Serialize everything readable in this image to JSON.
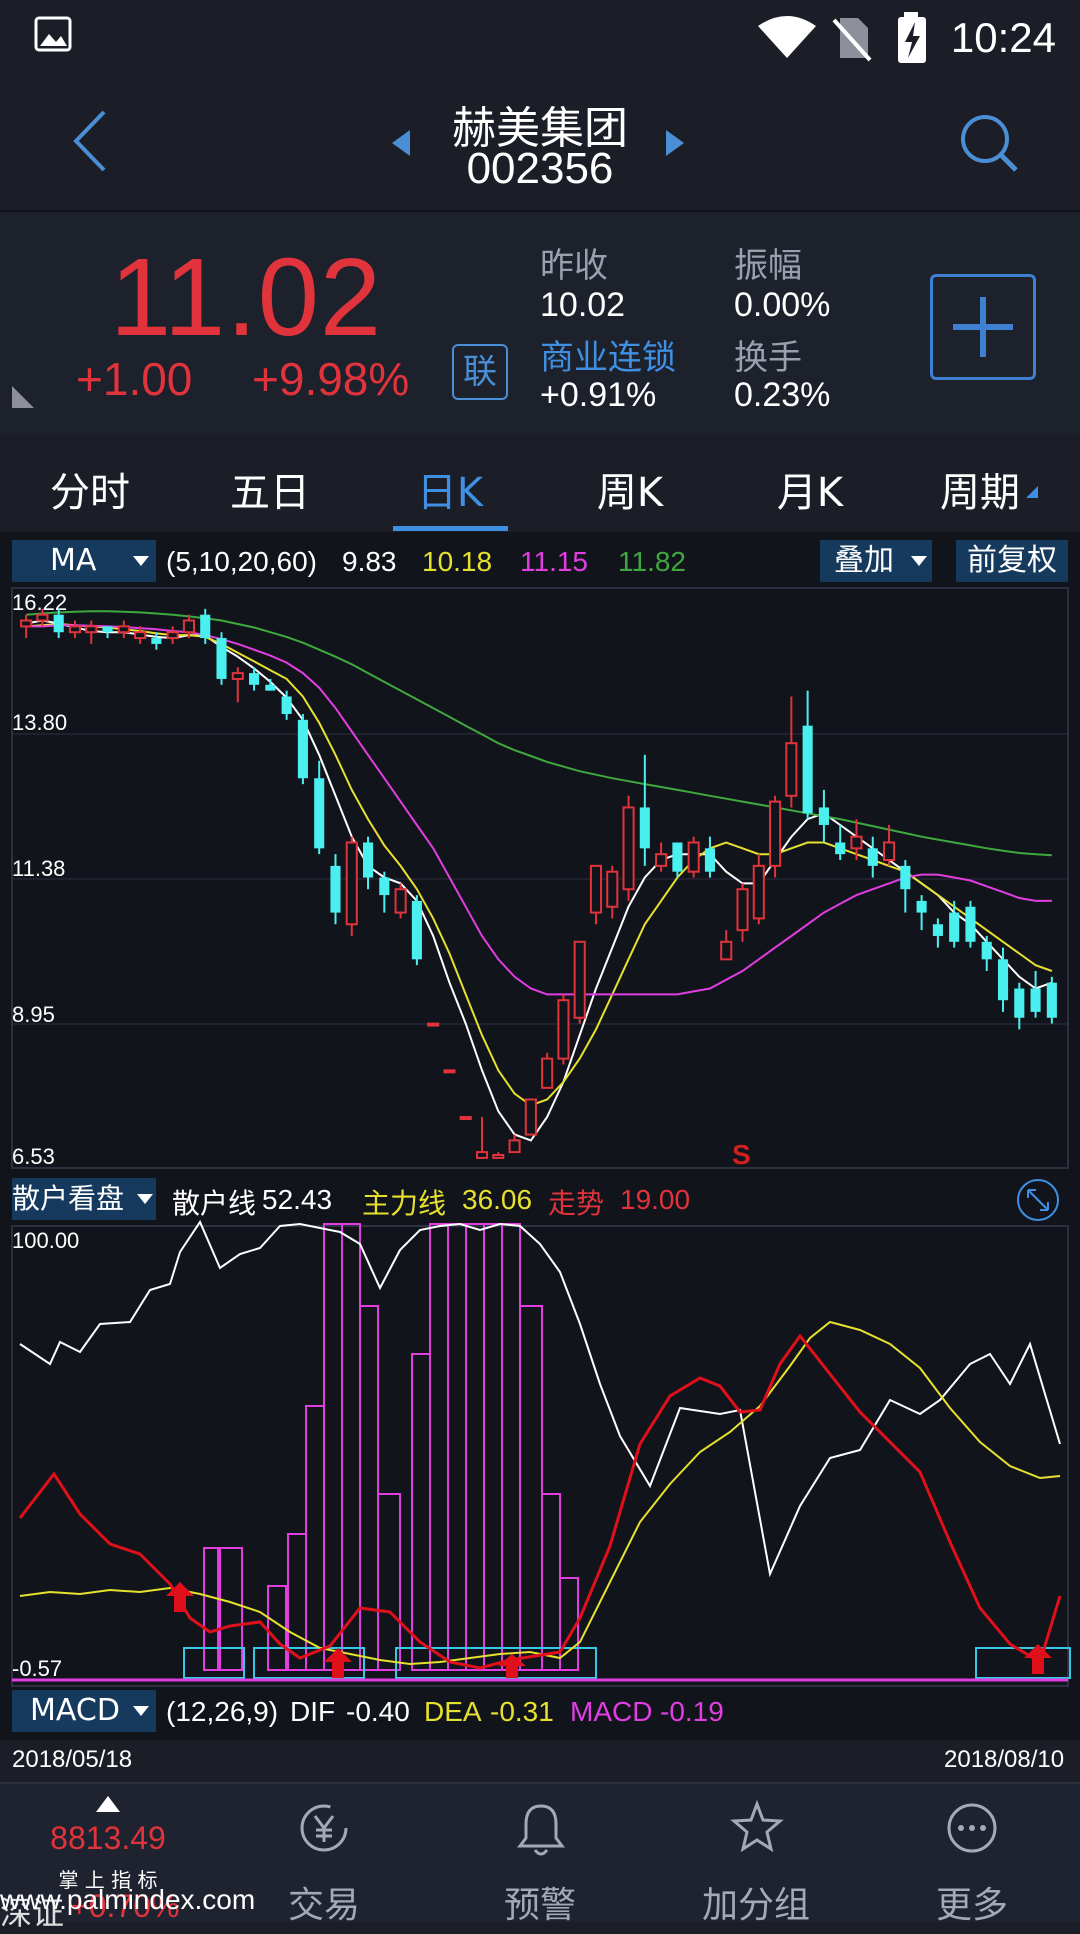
{
  "status": {
    "time": "10:24"
  },
  "header": {
    "name": "赫美集团",
    "code": "002356"
  },
  "quote": {
    "price": "11.02",
    "change": "+1.00",
    "change_pct": "+9.98%",
    "prev_close_label": "昨收",
    "prev_close": "10.02",
    "amplitude_label": "振幅",
    "amplitude": "0.00%",
    "sector": "商业连锁",
    "sector_change": "+0.91%",
    "turnover_label": "换手",
    "turnover": "0.23%",
    "lian": "联"
  },
  "tabs": [
    "分时",
    "五日",
    "日K",
    "周K",
    "月K",
    "周期"
  ],
  "active_tab": 2,
  "ma": {
    "selector": "MA",
    "params": "(5,10,20,60)",
    "v1": "9.83",
    "v2": "10.18",
    "v3": "11.15",
    "v4": "11.82",
    "overlay": "叠加",
    "adjust": "前复权",
    "y_labels": [
      "16.22",
      "13.80",
      "11.38",
      "8.95",
      "6.53"
    ],
    "s_mark": "S"
  },
  "retail": {
    "selector": "散户看盘",
    "label1": "散户线",
    "v1": "52.43",
    "label2": "主力线",
    "v2": "36.06",
    "label3": "走势",
    "v3": "19.00",
    "y_top": "100.00",
    "y_bottom": "-0.57"
  },
  "macd": {
    "selector": "MACD",
    "params": "(12,26,9)",
    "dif_label": "DIF",
    "dif": "-0.40",
    "dea_label": "DEA",
    "dea": "-0.31",
    "macd_label": "MACD",
    "macd": "-0.19",
    "date_start": "2018/05/18",
    "date_end": "2018/08/10"
  },
  "colors": {
    "up": "#e0333b",
    "down": "#4af0f0",
    "ma5": "#ffffff",
    "ma10": "#e6e02e",
    "ma20": "#e03ee0",
    "ma60": "#3fa83f"
  },
  "nav": {
    "index_value": "8813.49",
    "index_label": "掌 上 指 标",
    "index_name": "深证",
    "index_pct": "+0.70%",
    "watermark": "www.palmindex.com",
    "items": [
      "交易",
      "预警",
      "加分组",
      "更多"
    ]
  },
  "chart_data": {
    "type": "candlestick",
    "x_range": [
      "2018/05/18",
      "2018/08/10"
    ],
    "ylim": [
      6.53,
      16.22
    ],
    "y_ticks": [
      16.22,
      13.8,
      11.38,
      8.95,
      6.53
    ],
    "candles": [
      [
        15.7,
        15.8,
        15.5,
        15.9
      ],
      [
        15.8,
        15.9,
        15.7,
        16.0
      ],
      [
        15.9,
        15.6,
        15.5,
        16.0
      ],
      [
        15.6,
        15.7,
        15.5,
        15.8
      ],
      [
        15.6,
        15.7,
        15.4,
        15.8
      ],
      [
        15.7,
        15.6,
        15.5,
        15.7
      ],
      [
        15.6,
        15.7,
        15.5,
        15.8
      ],
      [
        15.5,
        15.6,
        15.4,
        15.7
      ],
      [
        15.5,
        15.4,
        15.3,
        15.6
      ],
      [
        15.5,
        15.6,
        15.4,
        15.7
      ],
      [
        15.6,
        15.8,
        15.5,
        15.9
      ],
      [
        15.9,
        15.5,
        15.4,
        16.0
      ],
      [
        15.5,
        14.8,
        14.7,
        15.6
      ],
      [
        14.8,
        14.9,
        14.4,
        15.0
      ],
      [
        14.9,
        14.7,
        14.6,
        15.0
      ],
      [
        14.7,
        14.6,
        14.6,
        14.8
      ],
      [
        14.5,
        14.2,
        14.1,
        14.6
      ],
      [
        14.1,
        13.1,
        13.0,
        14.2
      ],
      [
        13.1,
        11.9,
        11.8,
        13.4
      ],
      [
        11.6,
        10.8,
        10.6,
        11.8
      ],
      [
        10.6,
        12.0,
        10.4,
        12.1
      ],
      [
        12.0,
        11.4,
        11.2,
        12.1
      ],
      [
        11.4,
        11.1,
        10.8,
        11.5
      ],
      [
        10.8,
        11.2,
        10.7,
        11.3
      ],
      [
        11.0,
        10.0,
        9.9,
        11.1
      ],
      [
        8.9,
        8.9,
        8.9,
        8.9
      ],
      [
        8.1,
        8.1,
        8.1,
        8.1
      ],
      [
        7.3,
        7.3,
        7.3,
        7.3
      ],
      [
        6.6,
        6.7,
        6.6,
        7.3
      ],
      [
        6.6,
        6.65,
        6.6,
        6.7
      ],
      [
        6.7,
        6.9,
        6.7,
        7.0
      ],
      [
        7.0,
        7.6,
        7.0,
        7.6
      ],
      [
        7.8,
        8.3,
        7.8,
        8.4
      ],
      [
        8.3,
        9.3,
        8.2,
        9.4
      ],
      [
        9.0,
        10.3,
        8.9,
        10.3
      ],
      [
        10.8,
        11.6,
        10.6,
        11.6
      ],
      [
        10.9,
        11.5,
        10.7,
        11.6
      ],
      [
        11.2,
        12.6,
        11.0,
        12.8
      ],
      [
        12.6,
        11.9,
        11.6,
        13.5
      ],
      [
        11.6,
        11.8,
        11.5,
        12.0
      ],
      [
        12.0,
        11.5,
        11.4,
        12.0
      ],
      [
        11.5,
        12.0,
        11.4,
        12.1
      ],
      [
        11.9,
        11.5,
        11.4,
        12.1
      ],
      [
        10.0,
        10.3,
        10.0,
        10.5
      ],
      [
        10.5,
        11.2,
        10.3,
        11.3
      ],
      [
        10.7,
        11.6,
        10.6,
        11.8
      ],
      [
        11.6,
        12.7,
        11.4,
        12.8
      ],
      [
        12.8,
        13.7,
        12.6,
        14.5
      ],
      [
        14.0,
        12.5,
        12.4,
        14.6
      ],
      [
        12.6,
        12.3,
        12.0,
        12.9
      ],
      [
        12.0,
        11.8,
        11.7,
        12.3
      ],
      [
        11.9,
        12.1,
        11.7,
        12.4
      ],
      [
        11.9,
        11.6,
        11.4,
        12.1
      ],
      [
        11.7,
        12.0,
        11.6,
        12.3
      ],
      [
        11.6,
        11.2,
        10.8,
        11.7
      ],
      [
        11.0,
        10.8,
        10.5,
        11.1
      ],
      [
        10.6,
        10.4,
        10.2,
        10.7
      ],
      [
        10.8,
        10.3,
        10.2,
        11.0
      ],
      [
        10.9,
        10.3,
        10.2,
        11.0
      ],
      [
        10.3,
        10.0,
        9.8,
        10.4
      ],
      [
        10.0,
        9.3,
        9.1,
        10.2
      ],
      [
        9.5,
        9.0,
        8.8,
        9.6
      ],
      [
        9.5,
        9.1,
        9.0,
        9.8
      ],
      [
        9.6,
        9.0,
        8.9,
        9.7
      ]
    ],
    "series": [
      {
        "name": "MA5",
        "values": [
          15.75,
          15.8,
          15.75,
          15.68,
          15.62,
          15.6,
          15.6,
          15.56,
          15.52,
          15.5,
          15.55,
          15.54,
          15.35,
          15.18,
          14.98,
          14.75,
          14.48,
          14.1,
          13.5,
          12.8,
          12.1,
          11.6,
          11.4,
          11.3,
          11.0,
          10.4,
          9.6,
          8.9,
          8.1,
          7.4,
          7.0,
          6.9,
          7.3,
          7.9,
          8.7,
          9.5,
          10.2,
          10.9,
          11.4,
          11.7,
          11.8,
          11.8,
          11.8,
          11.5,
          11.3,
          11.3,
          11.7,
          12.1,
          12.4,
          12.5,
          12.3,
          12.1,
          11.9,
          11.7,
          11.5,
          11.3,
          11.1,
          10.8,
          10.6,
          10.3,
          10.0,
          9.7,
          9.5,
          9.6
        ]
      },
      {
        "name": "MA10",
        "values": [
          15.7,
          15.72,
          15.74,
          15.72,
          15.7,
          15.68,
          15.65,
          15.62,
          15.58,
          15.55,
          15.55,
          15.52,
          15.4,
          15.25,
          15.1,
          14.95,
          14.8,
          14.5,
          14.05,
          13.5,
          12.9,
          12.4,
          11.95,
          11.6,
          11.2,
          10.7,
          10.1,
          9.4,
          8.7,
          8.1,
          7.7,
          7.5,
          7.6,
          7.9,
          8.3,
          8.8,
          9.4,
          10.0,
          10.6,
          11.0,
          11.4,
          11.7,
          11.9,
          12.0,
          11.9,
          11.8,
          11.8,
          11.9,
          12.0,
          12.0,
          11.9,
          11.8,
          11.7,
          11.6,
          11.5,
          11.3,
          11.1,
          10.9,
          10.7,
          10.5,
          10.3,
          10.1,
          9.9,
          9.8
        ]
      },
      {
        "name": "MA20",
        "values": [
          15.7,
          15.7,
          15.72,
          15.72,
          15.71,
          15.7,
          15.69,
          15.67,
          15.65,
          15.62,
          15.6,
          15.55,
          15.48,
          15.4,
          15.3,
          15.2,
          15.08,
          14.9,
          14.65,
          14.3,
          13.9,
          13.5,
          13.1,
          12.7,
          12.3,
          11.9,
          11.4,
          10.9,
          10.4,
          10.0,
          9.7,
          9.5,
          9.4,
          9.4,
          9.4,
          9.4,
          9.4,
          9.4,
          9.4,
          9.4,
          9.4,
          9.45,
          9.5,
          9.65,
          9.8,
          10.0,
          10.2,
          10.4,
          10.6,
          10.8,
          10.95,
          11.1,
          11.2,
          11.3,
          11.4,
          11.45,
          11.45,
          11.4,
          11.35,
          11.25,
          11.15,
          11.05,
          11.0,
          11.0
        ]
      },
      {
        "name": "MA60",
        "values": [
          15.9,
          15.92,
          15.94,
          15.95,
          15.96,
          15.96,
          15.95,
          15.94,
          15.92,
          15.9,
          15.87,
          15.84,
          15.8,
          15.74,
          15.68,
          15.6,
          15.52,
          15.42,
          15.3,
          15.18,
          15.05,
          14.9,
          14.75,
          14.6,
          14.45,
          14.3,
          14.15,
          14.0,
          13.85,
          13.7,
          13.58,
          13.48,
          13.38,
          13.3,
          13.22,
          13.16,
          13.1,
          13.05,
          13.0,
          12.95,
          12.9,
          12.85,
          12.8,
          12.75,
          12.7,
          12.65,
          12.6,
          12.55,
          12.5,
          12.45,
          12.4,
          12.34,
          12.28,
          12.22,
          12.16,
          12.1,
          12.05,
          12.0,
          11.95,
          11.9,
          11.86,
          11.82,
          11.8,
          11.78
        ]
      }
    ]
  }
}
